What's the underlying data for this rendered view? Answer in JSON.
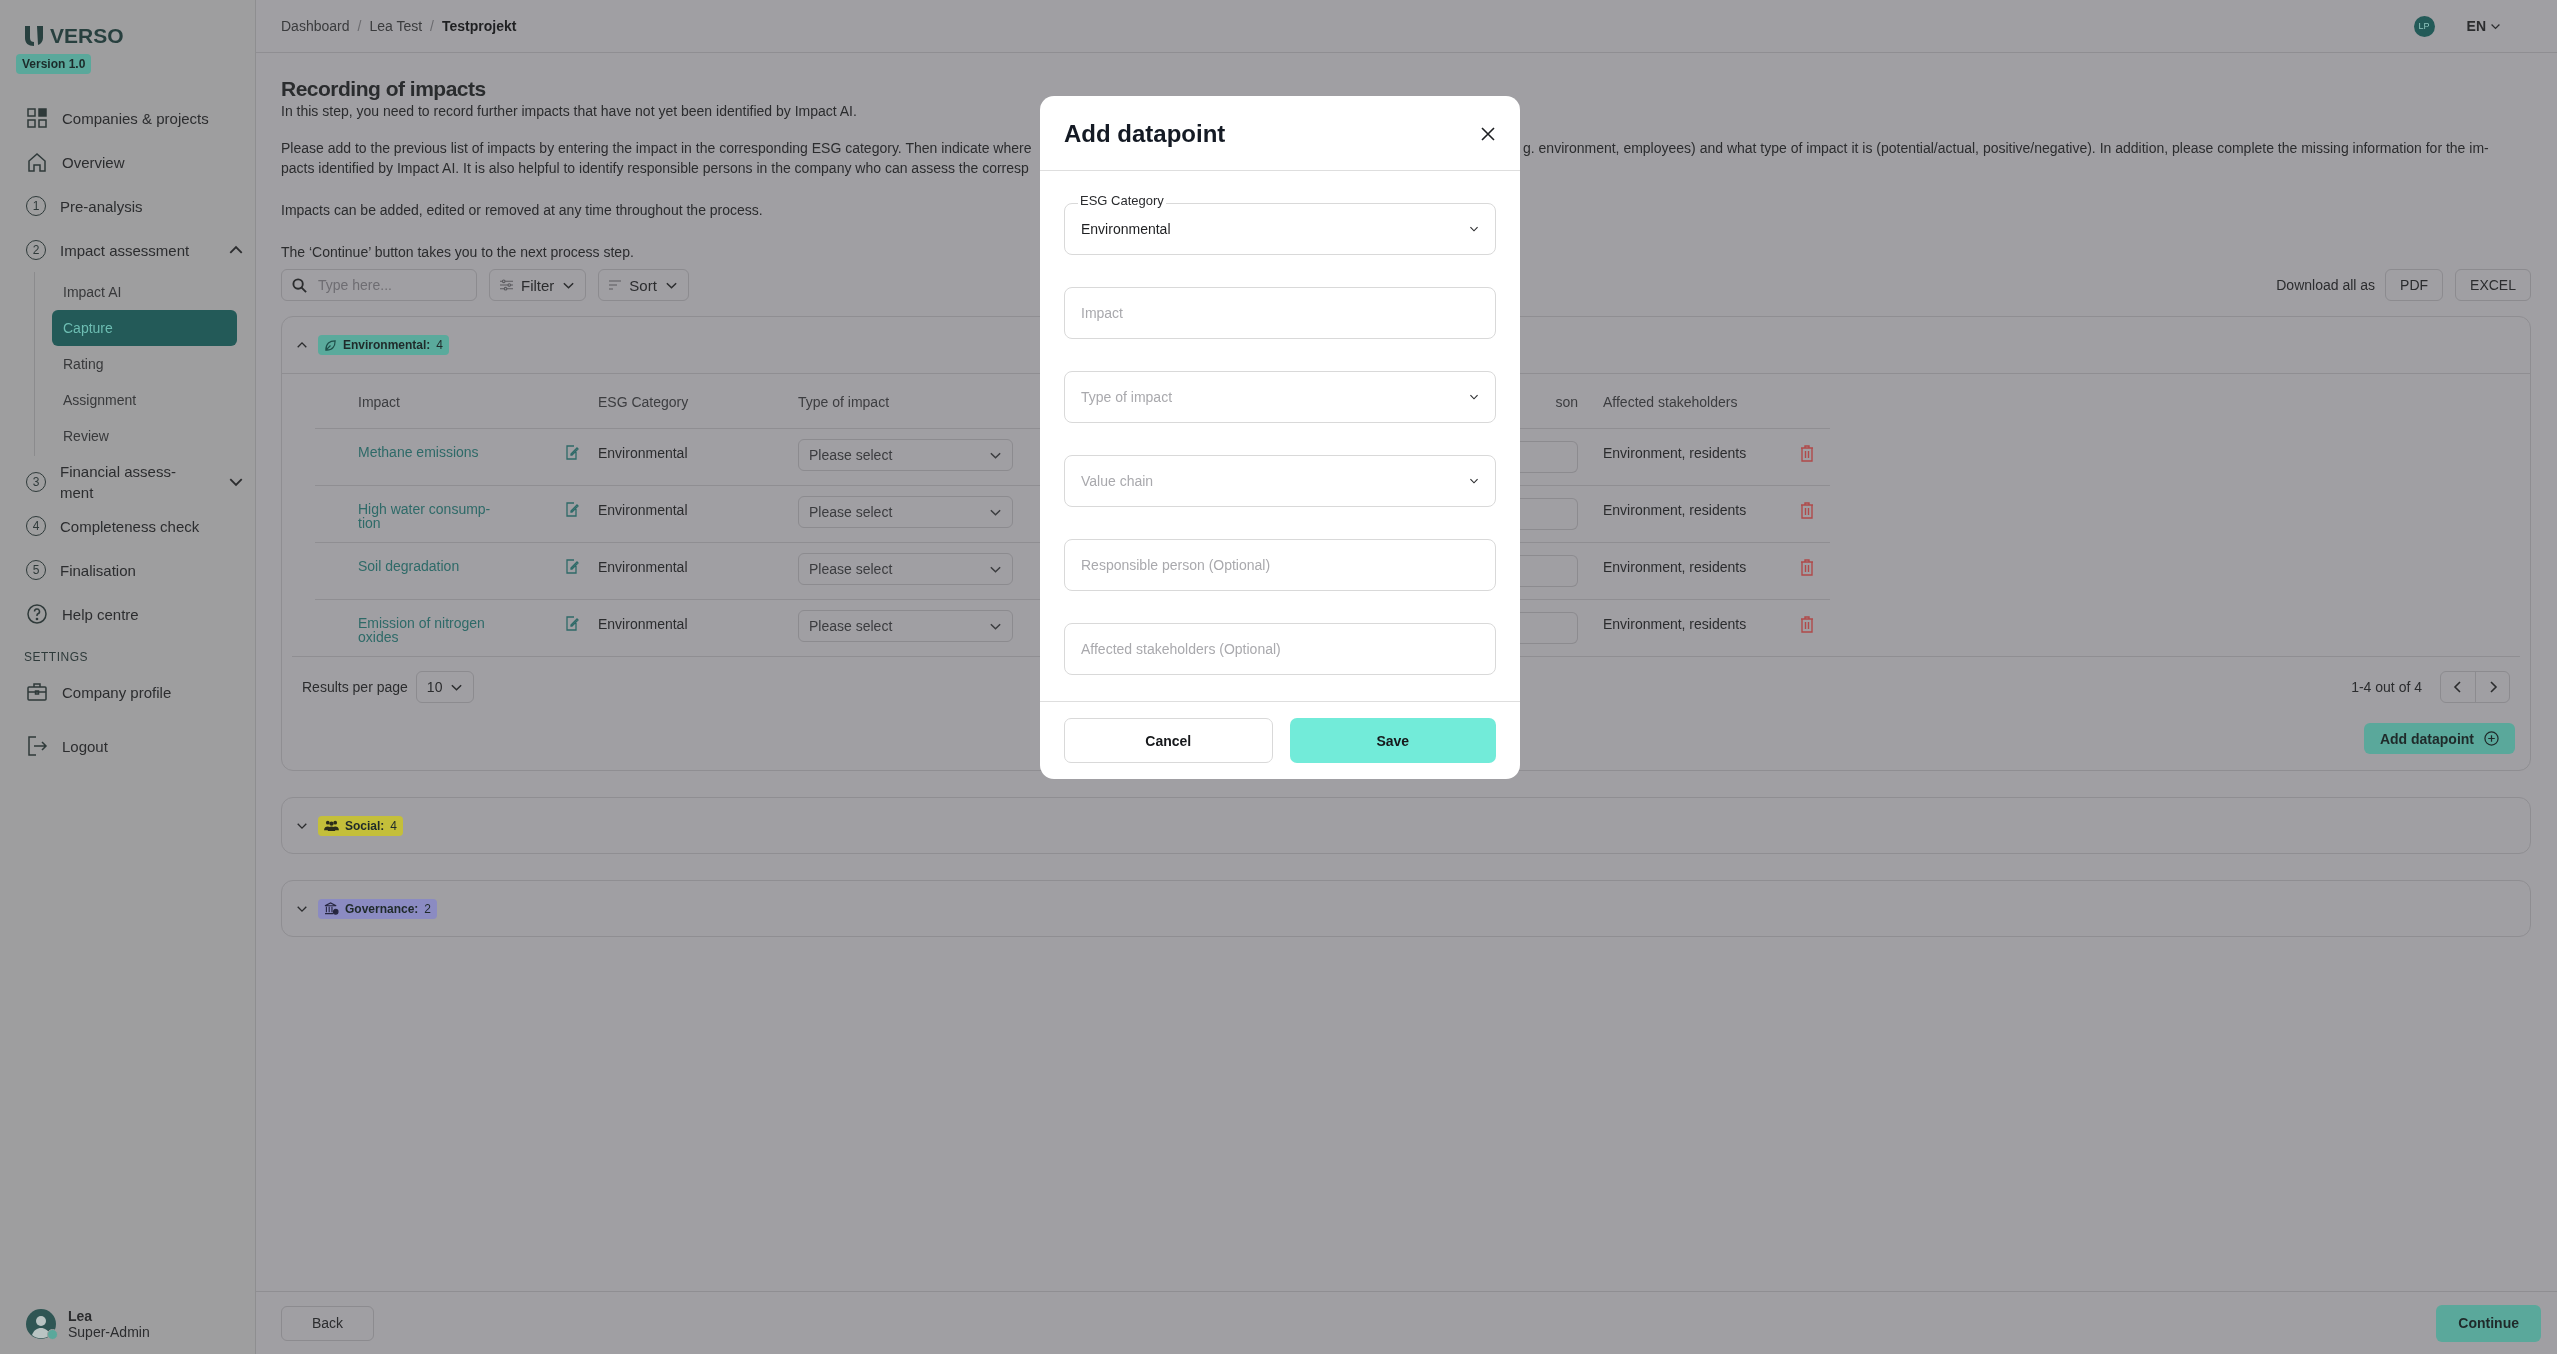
{
  "sidebar": {
    "logo": "VERSO",
    "version": "Version 1.0",
    "items": [
      {
        "label": "Companies & projects",
        "selected": false
      },
      {
        "label": "Overview",
        "selected": false
      },
      {
        "label": "Pre-analysis",
        "step": "1",
        "selected": false
      },
      {
        "label": "Impact assessment",
        "step": "2",
        "selected": false,
        "expanded": true,
        "children": [
          {
            "label": "Impact AI",
            "selected": false
          },
          {
            "label": "Capture",
            "selected": true
          },
          {
            "label": "Rating",
            "selected": false
          },
          {
            "label": "Assignment",
            "selected": false
          },
          {
            "label": "Review",
            "selected": false
          }
        ]
      },
      {
        "label": "Financial assess-ment",
        "step": "3",
        "selected": false,
        "expanded": false
      },
      {
        "label": "Completeness check",
        "step": "4",
        "selected": false
      },
      {
        "label": "Finalisation",
        "step": "5",
        "selected": false
      },
      {
        "label": "Help centre",
        "selected": false
      }
    ],
    "settings": {
      "label": "SETTINGS",
      "items": [
        {
          "label": "Company profile",
          "selected": false
        }
      ]
    },
    "logout": "Logout",
    "user": {
      "name": "Lea",
      "role": "Super-Admin",
      "online": true
    }
  },
  "header": {
    "separator": "/",
    "breadcrumbs": [
      {
        "label": "Dashboard",
        "current": false
      },
      {
        "label": "Lea Test",
        "current": false
      },
      {
        "label": "Testprojekt",
        "current": true
      }
    ],
    "avatar": "LP",
    "language": "EN"
  },
  "page": {
    "title": "Recording of impacts",
    "intro": "In this step, you need to record further impacts that have not yet been identified by Impact AI.",
    "instructions_left": [
      "Please add to the previous list of impacts by entering the impact in the corresponding ESG category. Then indicate where",
      "pacts identified by Impact AI. It is also helpful to identify responsible persons in the company who can assess the corresp"
    ],
    "instructions_right": [
      "g. environment, employees) and what type of impact it is (potential/actual, positive/negative). In addition, please complete the missing information for the im-"
    ],
    "notes": [
      "Impacts can be added, edited or removed at any time throughout the process.",
      "The ‘Continue’ button takes you to the next process step."
    ]
  },
  "toolbar": {
    "search": {
      "placeholder": "Type here..."
    },
    "filter": "Filter",
    "sort": "Sort",
    "download_label": "Download all as",
    "downloads": [
      "PDF",
      "EXCEL"
    ]
  },
  "groups": [
    {
      "kind": "environmental",
      "label": "Environmental:",
      "count": "4",
      "color": "#5aaa9c",
      "expanded": true,
      "table": {
        "columns": [
          "Impact",
          "ESG Category",
          "Type of impact",
          "son",
          "Affected stakeholders"
        ],
        "rows": [
          {
            "impact": "Methane emissions",
            "category": "Environmental",
            "type_placeholder": "Please select",
            "stakeholders": "Environment, residents"
          },
          {
            "impact": "High water consump-tion",
            "category": "Environmental",
            "type_placeholder": "Please select",
            "stakeholders": "Environment, residents"
          },
          {
            "impact": "Soil degradation",
            "category": "Environmental",
            "type_placeholder": "Please select",
            "stakeholders": "Environment, residents"
          },
          {
            "impact": "Emission of nitrogen oxides",
            "category": "Environmental",
            "type_placeholder": "Please select",
            "stakeholders": "Environment, residents"
          }
        ],
        "results_label": "Results per page",
        "per_page": "10",
        "range": "1-4 out of 4",
        "add_button": "Add datapoint"
      }
    },
    {
      "kind": "social",
      "label": "Social:",
      "count": "4",
      "color": "#c4bf3a",
      "expanded": false
    },
    {
      "kind": "governance",
      "label": "Governance:",
      "count": "2",
      "color": "#8b8bc2",
      "expanded": false
    }
  ],
  "footer": {
    "back": "Back",
    "continue": "Continue"
  },
  "modal": {
    "title": "Add datapoint",
    "fields": [
      {
        "kind": "select",
        "label": "ESG Category",
        "value": "Environmental"
      },
      {
        "kind": "text",
        "placeholder": "Impact"
      },
      {
        "kind": "select",
        "placeholder": "Type of impact"
      },
      {
        "kind": "select",
        "placeholder": "Value chain"
      },
      {
        "kind": "text",
        "placeholder": "Responsible person (Optional)"
      },
      {
        "kind": "text",
        "placeholder": "Affected stakeholders (Optional)"
      }
    ],
    "cancel": "Cancel",
    "save": "Save"
  }
}
